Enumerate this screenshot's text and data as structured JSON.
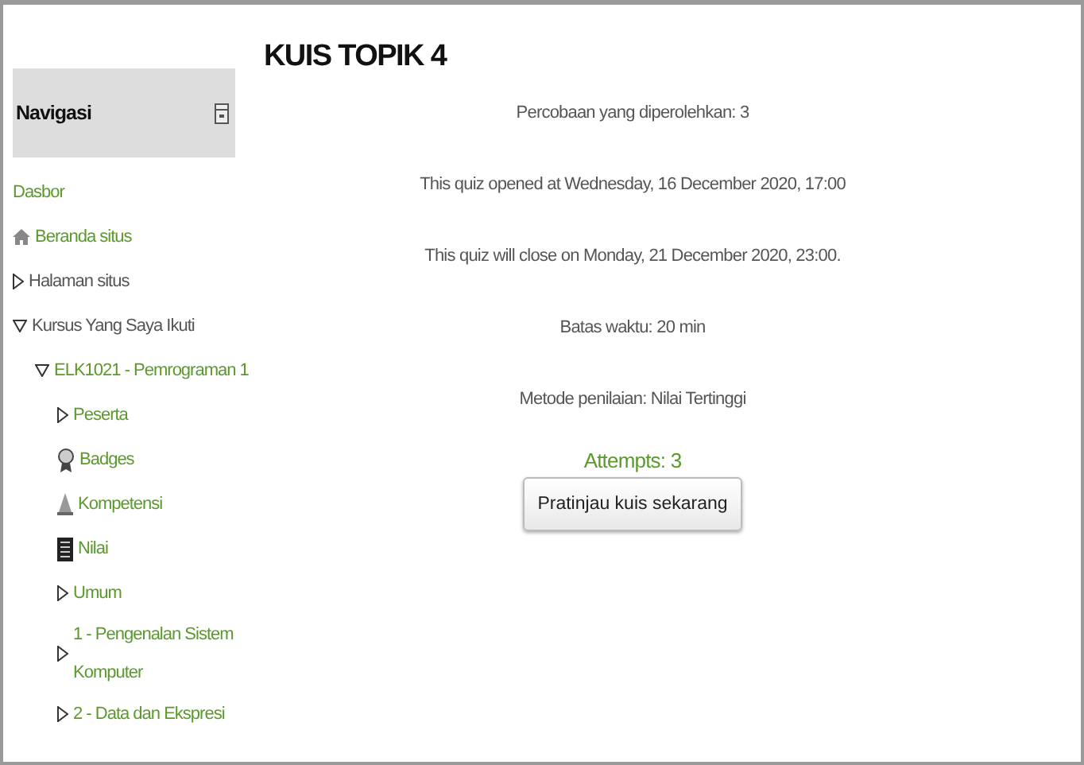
{
  "navigation": {
    "title": "Navigasi",
    "items": [
      {
        "kind": "link",
        "label": "Dasbor"
      },
      {
        "kind": "home",
        "label": "Beranda situs"
      },
      {
        "kind": "branch",
        "label": "Halaman situs",
        "expanded": false,
        "link": false
      },
      {
        "kind": "branch",
        "label": "Kursus Yang Saya Ikuti",
        "expanded": true,
        "link": false,
        "children": [
          {
            "kind": "branch",
            "label": "ELK1021 - Pemrograman 1",
            "expanded": true,
            "link": true,
            "children": [
              {
                "kind": "branch",
                "label": "Peserta",
                "expanded": false,
                "link": true
              },
              {
                "kind": "badge",
                "label": "Badges"
              },
              {
                "kind": "competency",
                "label": "Kompetensi"
              },
              {
                "kind": "grades",
                "label": "Nilai"
              },
              {
                "kind": "branch",
                "label": "Umum",
                "expanded": false,
                "link": true
              },
              {
                "kind": "branch",
                "label": "1 - Pengenalan Sistem Komputer",
                "expanded": false,
                "link": true
              },
              {
                "kind": "branch",
                "label": "2 - Data dan Ekspresi",
                "expanded": false,
                "link": true
              }
            ]
          }
        ]
      }
    ]
  },
  "quiz": {
    "title": "KUIS TOPIK 4",
    "info": [
      "Percobaan yang diperolehkan: 3",
      "This quiz opened at Wednesday, 16 December 2020, 17:00",
      "This quiz will close on Monday, 21 December 2020, 23:00.",
      "Batas waktu: 20 min",
      "Metode penilaian: Nilai Tertinggi"
    ],
    "attempts": "Attempts: 3",
    "button": "Pratinjau kuis sekarang"
  }
}
